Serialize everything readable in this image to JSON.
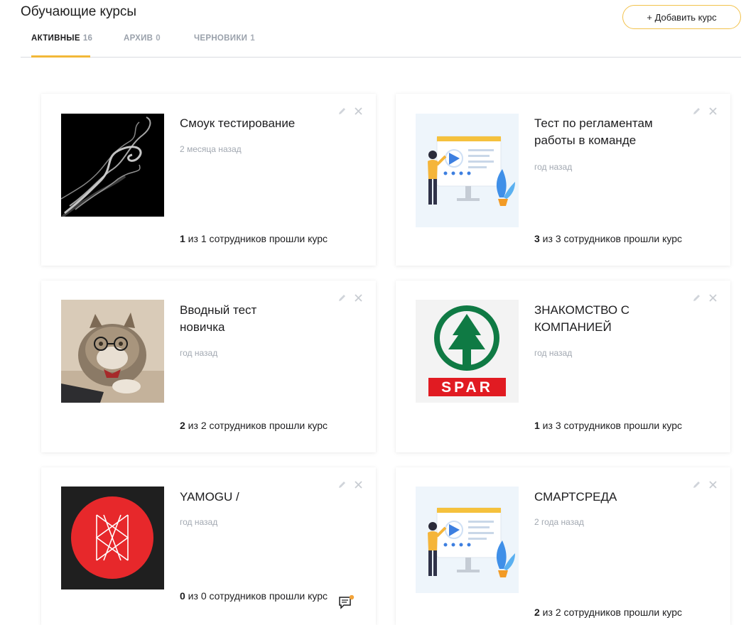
{
  "header": {
    "title": "Обучающие курсы",
    "add_button": "+ Добавить курс"
  },
  "tabs": [
    {
      "label": "АКТИВНЫЕ",
      "count": "16",
      "active": true
    },
    {
      "label": "АРХИВ",
      "count": "0",
      "active": false
    },
    {
      "label": "ЧЕРНОВИКИ",
      "count": "1",
      "active": false
    }
  ],
  "courses": [
    {
      "title": "Смоук тестирование",
      "date": "2 месяца назад",
      "passed": "1",
      "progress_rest": " из 1 сотрудников прошли курс",
      "thumbnail": "smoke-image"
    },
    {
      "title": "Тест по регламентам работы в команде",
      "date": "год назад",
      "passed": "3",
      "progress_rest": " из 3 сотрудников прошли курс",
      "thumbnail": "presentation-illustration"
    },
    {
      "title": "Вводный тест новичка",
      "date": "год назад",
      "passed": "2",
      "progress_rest": " из 2 сотрудников прошли курс",
      "thumbnail": "cat-glasses-photo"
    },
    {
      "title": "ЗНАКОМСТВО С КОМПАНИЕЙ",
      "date": "год назад",
      "passed": "1",
      "progress_rest": " из 3 сотрудников прошли курс",
      "thumbnail": "spar-logo",
      "logo_text": "SPAR"
    },
    {
      "title": "YAMOGU /",
      "date": "год назад",
      "passed": "0",
      "progress_rest": " из 0 сотрудников прошли курс",
      "thumbnail": "yamogu-logo"
    },
    {
      "title": "СМАРТСРЕДА",
      "date": "2 года назад",
      "passed": "2",
      "progress_rest": " из 2 сотрудников прошли курс",
      "thumbnail": "presentation-illustration"
    }
  ],
  "colors": {
    "accent": "#f2b838",
    "spar_green": "#0f7a44",
    "spar_red": "#e11b22",
    "yamogu_red": "#e7282b"
  }
}
